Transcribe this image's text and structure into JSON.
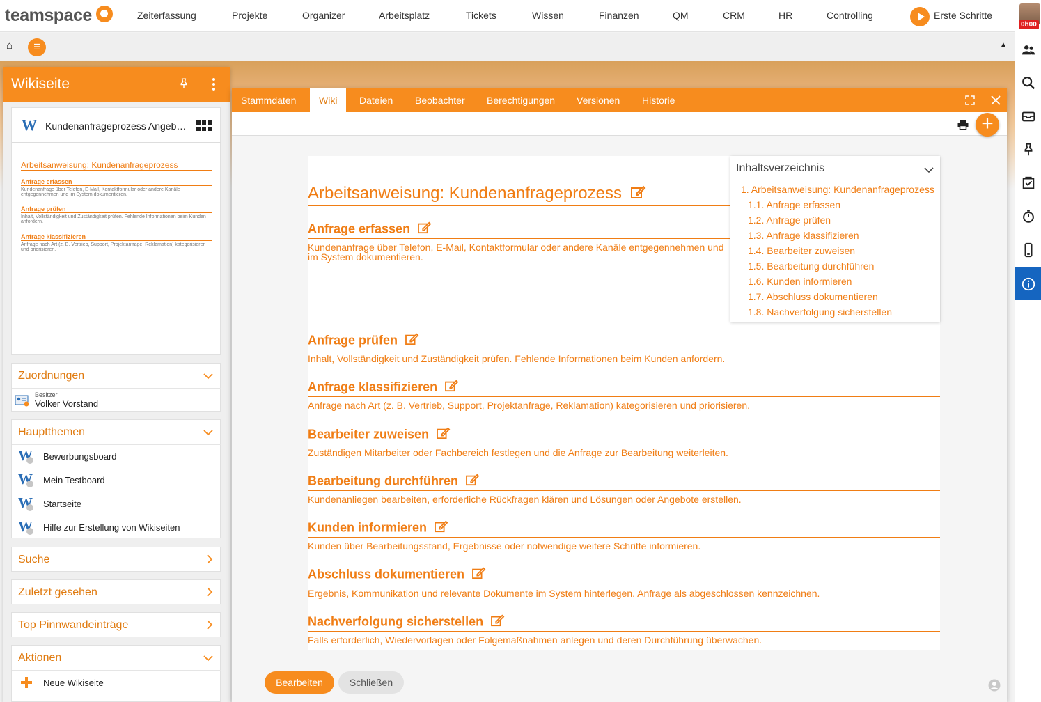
{
  "topnav": {
    "logo": "teamspace",
    "items": [
      "Zeiterfassung",
      "Projekte",
      "Organizer",
      "Arbeitsplatz",
      "Tickets",
      "Wissen",
      "Finanzen",
      "QM",
      "CRM",
      "HR",
      "Controlling"
    ],
    "erste_schritte": "Erste Schritte"
  },
  "user": {
    "timer": "0h00"
  },
  "leftpanel": {
    "title": "Wikiseite",
    "page_name": "Kundenanfrageprozess Angeb…",
    "preview": {
      "title": "Arbeitsanweisung: Kundenanfrageprozess",
      "sections": [
        {
          "h": "Anfrage erfassen",
          "t": "Kundenanfrage über Telefon, E-Mail, Kontaktformular oder andere Kanäle entgegennehmen und im System dokumentieren."
        },
        {
          "h": "Anfrage prüfen",
          "t": "Inhalt, Vollständigkeit und Zuständigkeit prüfen. Fehlende Informationen beim Kunden anfordern."
        },
        {
          "h": "Anfrage klassifizieren",
          "t": "Anfrage nach Art (z. B. Vertrieb, Support, Projektanfrage, Reklamation) kategorisieren und priorisieren."
        }
      ]
    },
    "zuordnungen": {
      "title": "Zuordnungen",
      "owner_label": "Besitzer",
      "owner_name": "Volker Vorstand"
    },
    "hauptthemen": {
      "title": "Hauptthemen",
      "items": [
        "Bewerbungsboard",
        "Mein Testboard",
        "Startseite",
        "Hilfe zur Erstellung von Wikiseiten"
      ]
    },
    "suche": "Suche",
    "zuletzt": "Zuletzt gesehen",
    "pinnwand": "Top Pinnwandeinträge",
    "aktionen": {
      "title": "Aktionen",
      "items": [
        "Neue Wikiseite"
      ]
    }
  },
  "main": {
    "tabs": [
      "Stammdaten",
      "Wiki",
      "Dateien",
      "Beobachter",
      "Berechtigungen",
      "Versionen",
      "Historie"
    ],
    "active_tab": "Wiki",
    "doc_title": "Arbeitsanweisung: Kundenanfrageprozess",
    "sections": [
      {
        "heading": "Anfrage erfassen",
        "text": "Kundenanfrage über Telefon, E-Mail, Kontaktformular oder andere Kanäle entgegennehmen und",
        "text2": "im System dokumentieren."
      },
      {
        "heading": "Anfrage prüfen",
        "text": "Inhalt, Vollständigkeit und Zuständigkeit prüfen. Fehlende Informationen beim Kunden anfordern."
      },
      {
        "heading": "Anfrage klassifizieren",
        "text": "Anfrage nach Art (z. B. Vertrieb, Support, Projektanfrage, Reklamation) kategorisieren und priorisieren."
      },
      {
        "heading": "Bearbeiter zuweisen",
        "text": "Zuständigen Mitarbeiter oder Fachbereich festlegen und die Anfrage zur Bearbeitung weiterleiten."
      },
      {
        "heading": "Bearbeitung durchführen",
        "text": "Kundenanliegen bearbeiten, erforderliche Rückfragen klären und Lösungen oder Angebote erstellen."
      },
      {
        "heading": "Kunden informieren",
        "text": "Kunden über Bearbeitungsstand, Ergebnisse oder notwendige weitere Schritte informieren."
      },
      {
        "heading": "Abschluss dokumentieren",
        "text": "Ergebnis, Kommunikation und relevante Dokumente im System hinterlegen. Anfrage als abgeschlossen kennzeichnen."
      },
      {
        "heading": "Nachverfolgung sicherstellen",
        "text": "Falls erforderlich, Wiedervorlagen oder Folgemaßnahmen anlegen und deren Durchführung überwachen."
      }
    ],
    "toc": {
      "title": "Inhaltsverzeichnis",
      "root": "1. Arbeitsanweisung: Kundenanfrageprozess",
      "items": [
        "1.1. Anfrage erfassen",
        "1.2. Anfrage prüfen",
        "1.3. Anfrage klassifizieren",
        "1.4. Bearbeiter zuweisen",
        "1.5. Bearbeitung durchführen",
        "1.6. Kunden informieren",
        "1.7. Abschluss dokumentieren",
        "1.8. Nachverfolgung sicherstellen"
      ]
    },
    "buttons": {
      "edit": "Bearbeiten",
      "close": "Schließen"
    }
  },
  "colors": {
    "accent": "#f78c1e",
    "heading": "#f07d14",
    "info_active": "#1565c0"
  }
}
